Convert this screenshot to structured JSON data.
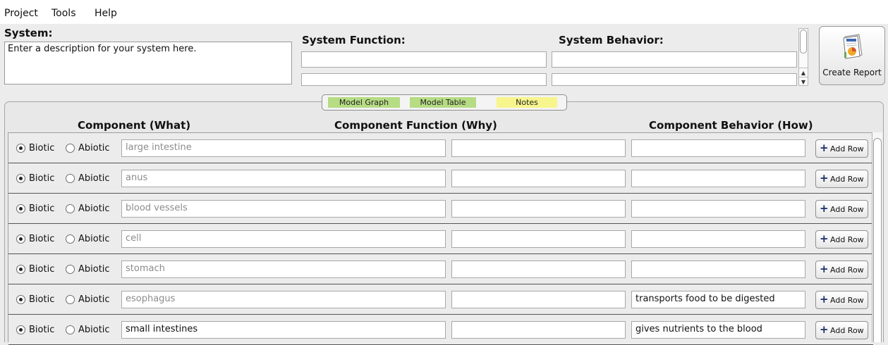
{
  "menu": {
    "project": "Project",
    "tools": "Tools",
    "help": "Help"
  },
  "system": {
    "label": "System:",
    "description": "Enter a description for your system here.",
    "function_label": "System Function:",
    "behavior_label": "System Behavior:",
    "function_fields": [
      "",
      ""
    ],
    "behavior_fields": [
      "",
      ""
    ]
  },
  "report_button": {
    "label": "Create Report",
    "icon": "report-document-icon"
  },
  "tabs": [
    {
      "label": "Model Graph",
      "color": "#b6dc84"
    },
    {
      "label": "Model Table",
      "color": "#b6dc84"
    },
    {
      "label": "Notes",
      "color": "#f7f58c"
    }
  ],
  "table": {
    "headers": {
      "component": "Component (What)",
      "function": "Component Function (Why)",
      "behavior": "Component Behavior (How)"
    },
    "radio_biotic": "Biotic",
    "radio_abiotic": "Abiotic",
    "add_row_label": "Add Row",
    "rows": [
      {
        "component": "large intestine",
        "component_placeholder": true,
        "function": "",
        "behavior": "",
        "biotic": true
      },
      {
        "component": "anus",
        "component_placeholder": true,
        "function": "",
        "behavior": "",
        "biotic": true
      },
      {
        "component": "blood vessels",
        "component_placeholder": true,
        "function": "",
        "behavior": "",
        "biotic": true
      },
      {
        "component": "cell",
        "component_placeholder": true,
        "function": "",
        "behavior": "",
        "biotic": true
      },
      {
        "component": "stomach",
        "component_placeholder": true,
        "function": "",
        "behavior": "",
        "biotic": true
      },
      {
        "component": "esophagus",
        "component_placeholder": true,
        "function": "",
        "behavior": "transports food to be digested",
        "biotic": true
      },
      {
        "component": "small intestines",
        "component_placeholder": false,
        "function": "",
        "behavior": "gives nutrients to the blood",
        "biotic": true
      }
    ]
  }
}
